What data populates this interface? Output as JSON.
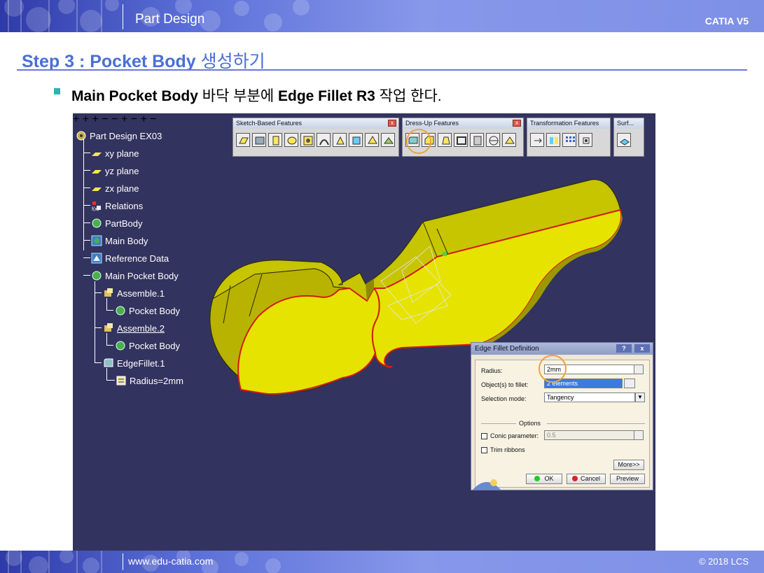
{
  "header": {
    "title": "Part Design",
    "brand": "CATIA V5"
  },
  "step": {
    "title_bold": "Step 3 : Pocket Body",
    "title_rest": " 생성하기"
  },
  "bullet": {
    "b1": "Main Pocket Body",
    "t1": " 바닥 부분에 ",
    "b2": "Edge Fillet R3",
    "t2": " 작업 한다."
  },
  "tree": {
    "root": "Part Design EX03",
    "items": [
      "xy plane",
      "yz plane",
      "zx plane",
      "Relations",
      "PartBody",
      "Main Body",
      "Reference Data",
      "Main Pocket Body",
      "Assemble.1",
      "Pocket Body",
      "Assemble.2",
      "Pocket Body",
      "EdgeFillet.1",
      "Radius=2mm"
    ]
  },
  "toolbars": {
    "sketch": "Sketch-Based Features",
    "dressup": "Dress-Up Features",
    "transform": "Transformation Features",
    "surf": "Surf..."
  },
  "dialog": {
    "title": "Edge Fillet Definition",
    "help": "?",
    "close": "x",
    "radius_label": "Radius:",
    "radius_value": "2mm",
    "objects_label": "Object(s) to fillet:",
    "objects_value": "2 elements",
    "mode_label": "Selection mode:",
    "mode_value": "Tangency",
    "options_label": "Options",
    "conic_label": "Conic parameter:",
    "conic_value": "0.5",
    "trim_label": "Trim ribbons",
    "more_label": "More>>",
    "ok_label": "OK",
    "cancel_label": "Cancel",
    "preview_label": "Preview"
  },
  "footer": {
    "url": "www.edu-catia.com",
    "copyright": "© 2018 LCS"
  },
  "colors": {
    "accent": "#4a6fd6",
    "viewport": "#33335f",
    "part": "#d6d400",
    "edge": "#d41a10"
  }
}
